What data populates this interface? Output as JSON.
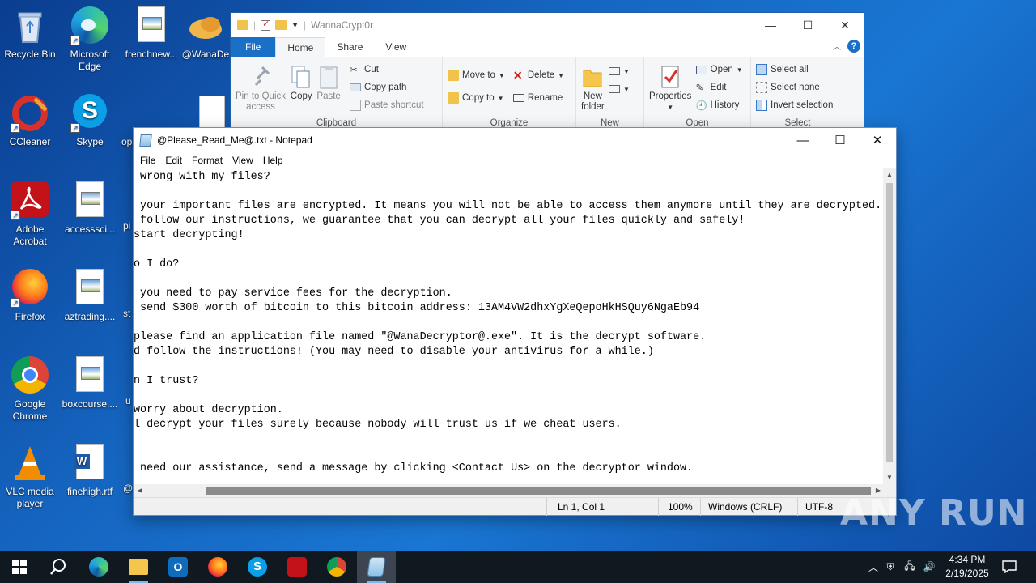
{
  "desktop": {
    "icons": [
      {
        "label": "Recycle Bin",
        "icon": "recycle-bin-icon"
      },
      {
        "label": "Microsoft Edge",
        "icon": "edge-icon"
      },
      {
        "label": "frenchnew...",
        "icon": "image-file-icon"
      },
      {
        "label": "@WanaDe",
        "icon": "wanadecryptor-icon"
      },
      {
        "label": "CCleaner",
        "icon": "ccleaner-icon"
      },
      {
        "label": "Skype",
        "icon": "skype-icon"
      },
      {
        "label": "op",
        "icon": "word-file-icon"
      },
      {
        "label": "Adobe Acrobat",
        "icon": "acrobat-icon"
      },
      {
        "label": "accesssci...",
        "icon": "image-file-icon"
      },
      {
        "label": "pi",
        "icon": "file-icon"
      },
      {
        "label": "Firefox",
        "icon": "firefox-icon"
      },
      {
        "label": "aztrading....",
        "icon": "image-file-icon"
      },
      {
        "label": "st",
        "icon": "file-icon"
      },
      {
        "label": "Google Chrome",
        "icon": "chrome-icon"
      },
      {
        "label": "boxcourse....",
        "icon": "image-file-icon"
      },
      {
        "label": "u",
        "icon": "file-icon"
      },
      {
        "label": "VLC media player",
        "icon": "vlc-icon"
      },
      {
        "label": "finehigh.rtf",
        "icon": "word-file-icon"
      },
      {
        "label": "@",
        "icon": "file-icon"
      }
    ]
  },
  "explorer": {
    "title": "WannaCrypt0r",
    "tabs": [
      "File",
      "Home",
      "Share",
      "View"
    ],
    "active_tab": "Home",
    "groups": {
      "clipboard": {
        "name": "Clipboard",
        "pin_label_1": "Pin to Quick",
        "pin_label_2": "access",
        "copy": "Copy",
        "paste": "Paste",
        "cut": "Cut",
        "copy_path": "Copy path",
        "paste_shortcut": "Paste shortcut"
      },
      "organize": {
        "name": "Organize",
        "move_to": "Move to",
        "copy_to": "Copy to",
        "delete": "Delete",
        "rename": "Rename"
      },
      "new": {
        "name": "New",
        "new_folder_1": "New",
        "new_folder_2": "folder"
      },
      "open": {
        "name": "Open",
        "properties": "Properties",
        "open": "Open",
        "edit": "Edit",
        "history": "History"
      },
      "select": {
        "name": "Select",
        "select_all": "Select all",
        "select_none": "Select none",
        "invert": "Invert selection"
      }
    }
  },
  "notepad": {
    "title": "@Please_Read_Me@.txt - Notepad",
    "menu": [
      "File",
      "Edit",
      "Format",
      "View",
      "Help"
    ],
    "lines": [
      " wrong with my files?",
      "",
      " your important files are encrypted. It means you will not be able to access them anymore until they are decrypted.",
      " follow our instructions, we guarantee that you can decrypt all your files quickly and safely!",
      "start decrypting!",
      "",
      "o I do?",
      "",
      " you need to pay service fees for the decryption.",
      " send $300 worth of bitcoin to this bitcoin address: 13AM4VW2dhxYgXeQepoHkHSQuy6NgaEb94",
      "",
      "please find an application file named \"@WanaDecryptor@.exe\". It is the decrypt software.",
      "d follow the instructions! (You may need to disable your antivirus for a while.)",
      "",
      "n I trust?",
      "",
      "worry about decryption.",
      "l decrypt your files surely because nobody will trust us if we cheat users.",
      "",
      "",
      " need our assistance, send a message by clicking <Contact Us> on the decryptor window."
    ],
    "status": {
      "position": "Ln 1, Col 1",
      "zoom": "100%",
      "line_ending": "Windows (CRLF)",
      "encoding": "UTF-8"
    }
  },
  "taskbar": {
    "apps": [
      "start-icon",
      "search-icon",
      "edge-icon",
      "file-explorer-icon",
      "outlook-icon",
      "firefox-icon",
      "skype-icon",
      "acrobat-icon",
      "chrome-icon",
      "notepad-icon"
    ],
    "time": "4:34 PM",
    "date": "2/19/2025"
  },
  "watermark": "ANY RUN"
}
